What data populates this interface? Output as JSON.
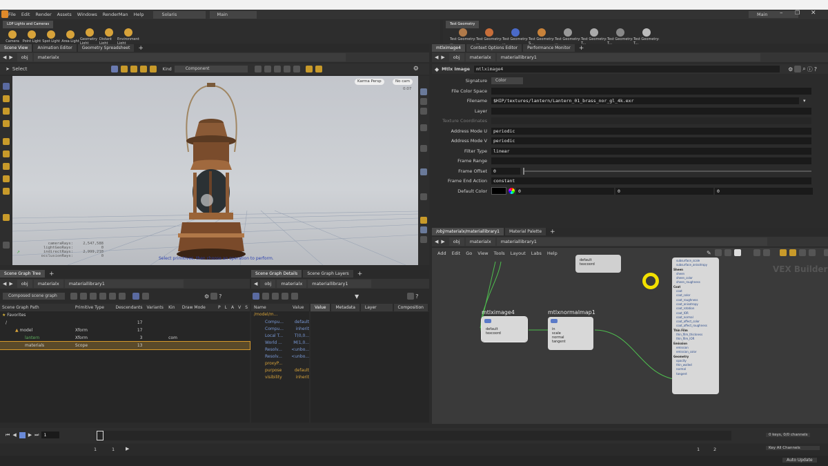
{
  "menubar": {
    "items": [
      "File",
      "Edit",
      "Render",
      "Assets",
      "Windows",
      "RenderMan",
      "Help"
    ],
    "desktop": "Solaris",
    "desktop2": "Main",
    "right_desktop": "Main"
  },
  "shelf_left": {
    "tab": "LOP Lights and Cameras",
    "tools": [
      "Camera",
      "Point Light",
      "Spot Light",
      "Area Light",
      "Geometry Light",
      "Distant Light",
      "Environment Light"
    ]
  },
  "shelf_right": {
    "tab": "Test Geometry",
    "tools": [
      "Test Geometry: ...",
      "Test Geometry: ...",
      "Test Geometry: ...",
      "Test Geometry: S...",
      "Test Geometry: ...",
      "Test Geometry: T...",
      "Test Geometry: T...",
      "Test Geometry: T..."
    ]
  },
  "viewer": {
    "tabs": [
      "Scene View",
      "Animation Editor",
      "Geometry Spreadsheet"
    ],
    "path": [
      "obj",
      "materialx"
    ],
    "select_label": "Select",
    "kind_label": "Kind",
    "kind_value": "Component",
    "camera_btn": "Karma Persp",
    "nocam_btn": "No cam",
    "corner_num": "0:07",
    "hint": "Select primitives, then choose an operation to perform.",
    "stats": [
      {
        "k": "cameraRays:",
        "v": "2,547,588"
      },
      {
        "k": "lightGeoRays:",
        "v": "0"
      },
      {
        "k": "indirectRays:",
        "v": "2,999,210"
      },
      {
        "k": "occlusionRays:",
        "v": "0"
      }
    ]
  },
  "scene_graph": {
    "tabs": [
      "Scene Graph Tree"
    ],
    "path": [
      "obj",
      "materialx",
      "materiallibrary1"
    ],
    "filter": "Composed scene graph",
    "headers": [
      "Scene Graph Path",
      "Primitive Type",
      "Descendants",
      "Variants",
      "Kin",
      "Draw Mode",
      "P",
      "L",
      "A",
      "V",
      "S"
    ],
    "rows": [
      {
        "name": "Favorites",
        "type": "",
        "desc": "",
        "kin": ""
      },
      {
        "name": "/",
        "type": "",
        "desc": "17",
        "kin": ""
      },
      {
        "name": "model",
        "type": "Xform",
        "desc": "17",
        "kin": ""
      },
      {
        "name": "lantern",
        "type": "Xform",
        "desc": "3",
        "kin": "com"
      },
      {
        "name": "materials",
        "type": "Scope",
        "desc": "13",
        "kin": ""
      }
    ]
  },
  "sg_details": {
    "tabs": [
      "Scene Graph Details",
      "Scene Graph Layers"
    ],
    "path": [
      "obj",
      "materialx",
      "materiallibrary1"
    ],
    "headers": [
      "Name",
      "Value"
    ],
    "right_tabs": [
      "Value",
      "Metadata",
      "Layer Stack",
      "Composition"
    ],
    "prim": "/model/m...",
    "rows": [
      {
        "n": "Compu...",
        "v": "default"
      },
      {
        "n": "Compu...",
        "v": "inherit"
      },
      {
        "n": "Local T...",
        "v": "T(0,0..."
      },
      {
        "n": "World ...",
        "v": "M(1,0..."
      },
      {
        "n": "Resolv...",
        "v": "<unbo..."
      },
      {
        "n": "Resolv...",
        "v": "<unbo..."
      },
      {
        "n": "proxyP...",
        "v": ""
      },
      {
        "n": "purpose",
        "v": "default"
      },
      {
        "n": "visibility",
        "v": "inherit"
      }
    ]
  },
  "params": {
    "tabs": [
      "mtlximage4",
      "Context Options Editor",
      "Performance Monitor"
    ],
    "path": [
      "obj",
      "materialx",
      "materiallibrary1"
    ],
    "node_type": "Mtlx Image",
    "node_name": "mtlximage4",
    "rows": [
      {
        "label": "Signature",
        "value": "Color"
      },
      {
        "label": "File Color Space",
        "value": ""
      },
      {
        "label": "Filename",
        "value": "$HIP/textures/lantern/Lantern_01_brass_nor_gl_4k.exr"
      },
      {
        "label": "Layer",
        "value": ""
      },
      {
        "label": "Texture Coordinates",
        "value": ""
      },
      {
        "label": "Address Mode U",
        "value": "periodic"
      },
      {
        "label": "Address Mode V",
        "value": "periodic"
      },
      {
        "label": "Filter Type",
        "value": "linear"
      },
      {
        "label": "Frame Range",
        "value": ""
      },
      {
        "label": "Frame Offset",
        "value": "0"
      },
      {
        "label": "Frame End Action",
        "value": "constant"
      },
      {
        "label": "Default Color",
        "value": "0"
      }
    ],
    "default_color": [
      "0",
      "0",
      "0"
    ]
  },
  "network": {
    "tabs": [
      "/obj/materialx/materiallibrary1",
      "Material Palette"
    ],
    "path": [
      "obj",
      "materialx",
      "materiallibrary1"
    ],
    "menu": [
      "Add",
      "Edit",
      "Go",
      "View",
      "Tools",
      "Layout",
      "Labs",
      "Help"
    ],
    "watermark": "VEX Builder",
    "node1": {
      "title": "mtlximage4",
      "ports": [
        "default",
        "texcoord"
      ]
    },
    "node2": {
      "title": "mtlxnormalmap1",
      "ports": [
        "in",
        "scale",
        "normal",
        "tangent"
      ]
    },
    "top_ports": [
      "default",
      "texcoord"
    ],
    "surface_ports": [
      "subsurface_scale",
      "subsurface_anisotropy",
      "Sheen",
      "sheen",
      "sheen_color",
      "sheen_roughness",
      "Coat",
      "coat",
      "coat_color",
      "coat_roughness",
      "coat_anisotropy",
      "coat_rotation",
      "coat_IOR",
      "coat_normal",
      "coat_affect_color",
      "coat_affect_roughness",
      "Thin Film",
      "thin_film_thickness",
      "thin_film_IOR",
      "Emission",
      "emission",
      "emission_color",
      "Geometry",
      "opacity",
      "thin_walled",
      "normal",
      "tangent"
    ]
  },
  "timeline": {
    "frame": "1",
    "start": "1",
    "start2": "1",
    "end": "1",
    "end2": "2",
    "keys": "0 keys, 0/0 channels",
    "key_all": "Key All Channels",
    "auto_update": "Auto Update"
  }
}
